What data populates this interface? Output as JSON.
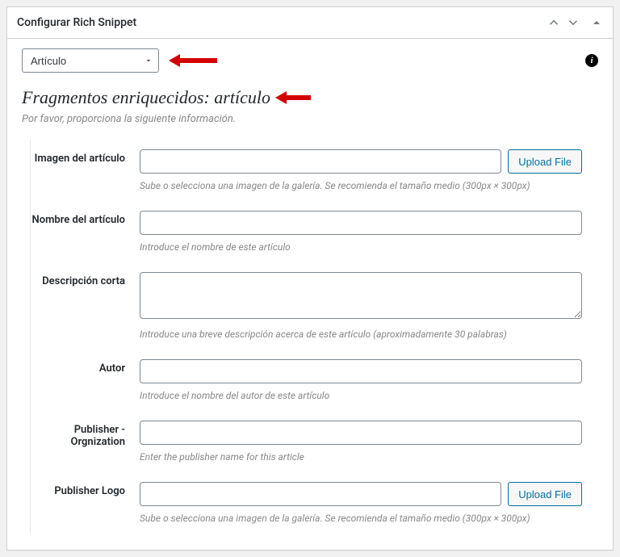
{
  "panel": {
    "title": "Configurar Rich Snippet"
  },
  "dropdown": {
    "selected": "Artículo"
  },
  "section": {
    "heading": "Fragmentos enriquecidos: artículo",
    "subtext": "Por favor, proporciona la siguiente información."
  },
  "fields": {
    "image": {
      "label": "Imagen del artículo",
      "button": "Upload File",
      "help": "Sube o selecciona una imagen de la galería. Se recomienda el tamaño medio (300px × 300px)"
    },
    "name": {
      "label": "Nombre del artículo",
      "help": "Introduce el nombre de este artículo"
    },
    "shortdesc": {
      "label": "Descripción corta",
      "help": "Introduce una breve descripción acerca de este artículo (aproximadamente 30 palabras)"
    },
    "author": {
      "label": "Autor",
      "help": "Introduce el nombre del autor de este artículo"
    },
    "publisher": {
      "label": "Publisher - Orgnization",
      "help": "Enter the publisher name for this article"
    },
    "publisher_logo": {
      "label": "Publisher Logo",
      "button": "Upload File",
      "help": "Sube o selecciona una imagen de la galería. Se recomienda el tamaño medio (300px × 300px)"
    }
  }
}
